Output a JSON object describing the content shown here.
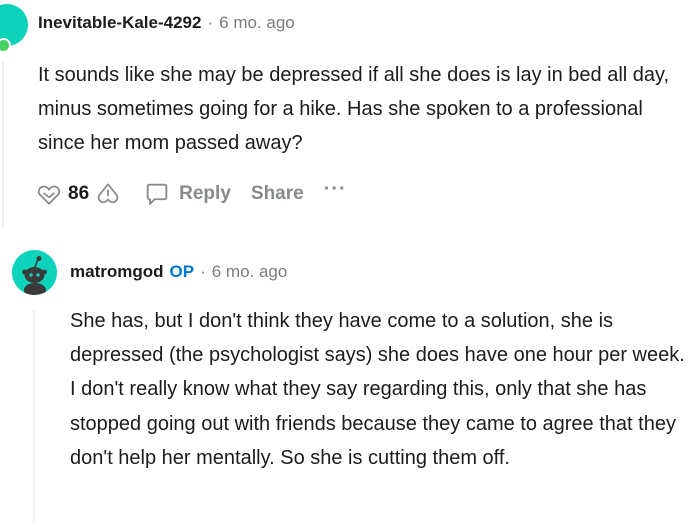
{
  "comments": [
    {
      "username": "Inevitable-Kale-4292",
      "separator": "·",
      "time": "6 mo. ago",
      "body": "It sounds like she may be depressed if all she does is lay in bed all day, minus sometimes going for a hike. Has she spoken to a professional since her mom passed away?",
      "votes": "86",
      "reply_label": "Reply",
      "share_label": "Share",
      "more_label": "···"
    },
    {
      "username": "matromgod",
      "op_badge": "OP",
      "separator": "·",
      "time": "6 mo. ago",
      "body": "She has, but I don't think they have come to a solution, she is depressed (the psychologist says) she does have one hour per week. I don't really know what they say regarding this, only that she has stopped going out with friends because they came to agree that they don't help her mentally. So she is cutting them off."
    }
  ],
  "colors": {
    "avatar": "#0dd3bb",
    "online": "#46d160",
    "op_badge": "#0079d3",
    "muted": "#7c7c7c"
  },
  "icons": {
    "upvote": "upvote-icon",
    "downvote": "downvote-icon",
    "reply": "speech-bubble-icon",
    "avatar": "snoo-avatar-icon"
  }
}
